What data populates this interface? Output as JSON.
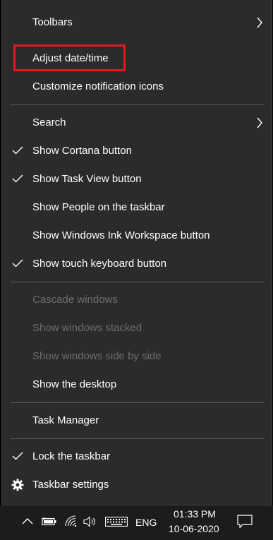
{
  "menu": {
    "items": [
      {
        "id": "toolbars",
        "label": "Toolbars",
        "submenu": true,
        "checked": false,
        "disabled": false
      },
      {
        "id": "adjust-datetime",
        "label": "Adjust date/time",
        "highlighted": true,
        "checked": false,
        "disabled": false
      },
      {
        "id": "customize-notification-icons",
        "label": "Customize notification icons",
        "checked": false,
        "disabled": false
      },
      {
        "id": "search",
        "label": "Search",
        "submenu": true,
        "checked": false,
        "disabled": false
      },
      {
        "id": "show-cortana-button",
        "label": "Show Cortana button",
        "checked": true,
        "disabled": false
      },
      {
        "id": "show-task-view-button",
        "label": "Show Task View button",
        "checked": true,
        "disabled": false
      },
      {
        "id": "show-people",
        "label": "Show People on the taskbar",
        "checked": false,
        "disabled": false
      },
      {
        "id": "show-ink-workspace",
        "label": "Show Windows Ink Workspace button",
        "checked": false,
        "disabled": false
      },
      {
        "id": "show-touch-keyboard",
        "label": "Show touch keyboard button",
        "checked": true,
        "disabled": false
      },
      {
        "id": "cascade-windows",
        "label": "Cascade windows",
        "checked": false,
        "disabled": true
      },
      {
        "id": "show-windows-stacked",
        "label": "Show windows stacked",
        "checked": false,
        "disabled": true
      },
      {
        "id": "show-windows-side-by-side",
        "label": "Show windows side by side",
        "checked": false,
        "disabled": true
      },
      {
        "id": "show-desktop",
        "label": "Show the desktop",
        "checked": false,
        "disabled": false
      },
      {
        "id": "task-manager",
        "label": "Task Manager",
        "checked": false,
        "disabled": false
      },
      {
        "id": "lock-taskbar",
        "label": "Lock the taskbar",
        "checked": true,
        "disabled": false
      },
      {
        "id": "taskbar-settings",
        "label": "Taskbar settings",
        "icon": "gear-icon",
        "checked": false,
        "disabled": false
      }
    ]
  },
  "taskbar": {
    "language": "ENG",
    "time": "01:33 PM",
    "date": "10-06-2020",
    "icons": [
      "chevron-up-icon",
      "battery-icon",
      "wifi-icon",
      "volume-icon",
      "keyboard-icon",
      "notification-icon"
    ]
  },
  "colors": {
    "menu_bg": "#2b2b2b",
    "text": "#ffffff",
    "disabled_text": "#6d6d6d",
    "highlight_border": "#e01b24",
    "taskbar_bg": "#1c1c1c"
  }
}
